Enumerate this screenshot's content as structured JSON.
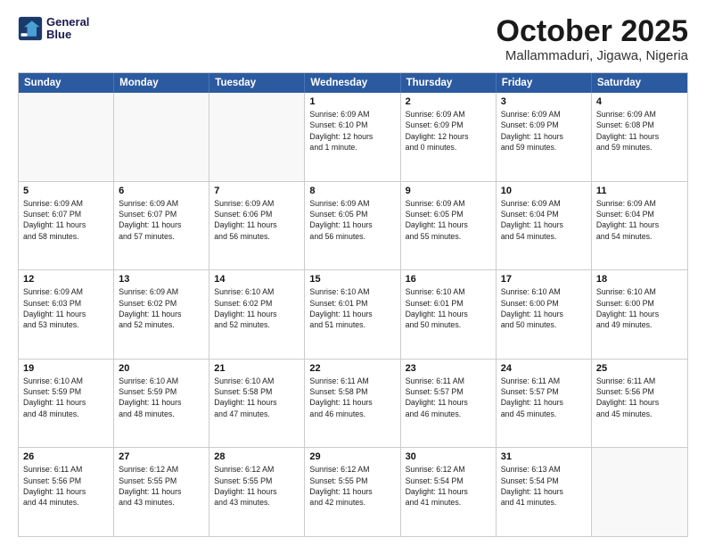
{
  "logo": {
    "line1": "General",
    "line2": "Blue"
  },
  "title": "October 2025",
  "location": "Mallammaduri, Jigawa, Nigeria",
  "weekdays": [
    "Sunday",
    "Monday",
    "Tuesday",
    "Wednesday",
    "Thursday",
    "Friday",
    "Saturday"
  ],
  "rows": [
    [
      {
        "day": "",
        "text": ""
      },
      {
        "day": "",
        "text": ""
      },
      {
        "day": "",
        "text": ""
      },
      {
        "day": "1",
        "text": "Sunrise: 6:09 AM\nSunset: 6:10 PM\nDaylight: 12 hours\nand 1 minute."
      },
      {
        "day": "2",
        "text": "Sunrise: 6:09 AM\nSunset: 6:09 PM\nDaylight: 12 hours\nand 0 minutes."
      },
      {
        "day": "3",
        "text": "Sunrise: 6:09 AM\nSunset: 6:09 PM\nDaylight: 11 hours\nand 59 minutes."
      },
      {
        "day": "4",
        "text": "Sunrise: 6:09 AM\nSunset: 6:08 PM\nDaylight: 11 hours\nand 59 minutes."
      }
    ],
    [
      {
        "day": "5",
        "text": "Sunrise: 6:09 AM\nSunset: 6:07 PM\nDaylight: 11 hours\nand 58 minutes."
      },
      {
        "day": "6",
        "text": "Sunrise: 6:09 AM\nSunset: 6:07 PM\nDaylight: 11 hours\nand 57 minutes."
      },
      {
        "day": "7",
        "text": "Sunrise: 6:09 AM\nSunset: 6:06 PM\nDaylight: 11 hours\nand 56 minutes."
      },
      {
        "day": "8",
        "text": "Sunrise: 6:09 AM\nSunset: 6:05 PM\nDaylight: 11 hours\nand 56 minutes."
      },
      {
        "day": "9",
        "text": "Sunrise: 6:09 AM\nSunset: 6:05 PM\nDaylight: 11 hours\nand 55 minutes."
      },
      {
        "day": "10",
        "text": "Sunrise: 6:09 AM\nSunset: 6:04 PM\nDaylight: 11 hours\nand 54 minutes."
      },
      {
        "day": "11",
        "text": "Sunrise: 6:09 AM\nSunset: 6:04 PM\nDaylight: 11 hours\nand 54 minutes."
      }
    ],
    [
      {
        "day": "12",
        "text": "Sunrise: 6:09 AM\nSunset: 6:03 PM\nDaylight: 11 hours\nand 53 minutes."
      },
      {
        "day": "13",
        "text": "Sunrise: 6:09 AM\nSunset: 6:02 PM\nDaylight: 11 hours\nand 52 minutes."
      },
      {
        "day": "14",
        "text": "Sunrise: 6:10 AM\nSunset: 6:02 PM\nDaylight: 11 hours\nand 52 minutes."
      },
      {
        "day": "15",
        "text": "Sunrise: 6:10 AM\nSunset: 6:01 PM\nDaylight: 11 hours\nand 51 minutes."
      },
      {
        "day": "16",
        "text": "Sunrise: 6:10 AM\nSunset: 6:01 PM\nDaylight: 11 hours\nand 50 minutes."
      },
      {
        "day": "17",
        "text": "Sunrise: 6:10 AM\nSunset: 6:00 PM\nDaylight: 11 hours\nand 50 minutes."
      },
      {
        "day": "18",
        "text": "Sunrise: 6:10 AM\nSunset: 6:00 PM\nDaylight: 11 hours\nand 49 minutes."
      }
    ],
    [
      {
        "day": "19",
        "text": "Sunrise: 6:10 AM\nSunset: 5:59 PM\nDaylight: 11 hours\nand 48 minutes."
      },
      {
        "day": "20",
        "text": "Sunrise: 6:10 AM\nSunset: 5:59 PM\nDaylight: 11 hours\nand 48 minutes."
      },
      {
        "day": "21",
        "text": "Sunrise: 6:10 AM\nSunset: 5:58 PM\nDaylight: 11 hours\nand 47 minutes."
      },
      {
        "day": "22",
        "text": "Sunrise: 6:11 AM\nSunset: 5:58 PM\nDaylight: 11 hours\nand 46 minutes."
      },
      {
        "day": "23",
        "text": "Sunrise: 6:11 AM\nSunset: 5:57 PM\nDaylight: 11 hours\nand 46 minutes."
      },
      {
        "day": "24",
        "text": "Sunrise: 6:11 AM\nSunset: 5:57 PM\nDaylight: 11 hours\nand 45 minutes."
      },
      {
        "day": "25",
        "text": "Sunrise: 6:11 AM\nSunset: 5:56 PM\nDaylight: 11 hours\nand 45 minutes."
      }
    ],
    [
      {
        "day": "26",
        "text": "Sunrise: 6:11 AM\nSunset: 5:56 PM\nDaylight: 11 hours\nand 44 minutes."
      },
      {
        "day": "27",
        "text": "Sunrise: 6:12 AM\nSunset: 5:55 PM\nDaylight: 11 hours\nand 43 minutes."
      },
      {
        "day": "28",
        "text": "Sunrise: 6:12 AM\nSunset: 5:55 PM\nDaylight: 11 hours\nand 43 minutes."
      },
      {
        "day": "29",
        "text": "Sunrise: 6:12 AM\nSunset: 5:55 PM\nDaylight: 11 hours\nand 42 minutes."
      },
      {
        "day": "30",
        "text": "Sunrise: 6:12 AM\nSunset: 5:54 PM\nDaylight: 11 hours\nand 41 minutes."
      },
      {
        "day": "31",
        "text": "Sunrise: 6:13 AM\nSunset: 5:54 PM\nDaylight: 11 hours\nand 41 minutes."
      },
      {
        "day": "",
        "text": ""
      }
    ]
  ]
}
